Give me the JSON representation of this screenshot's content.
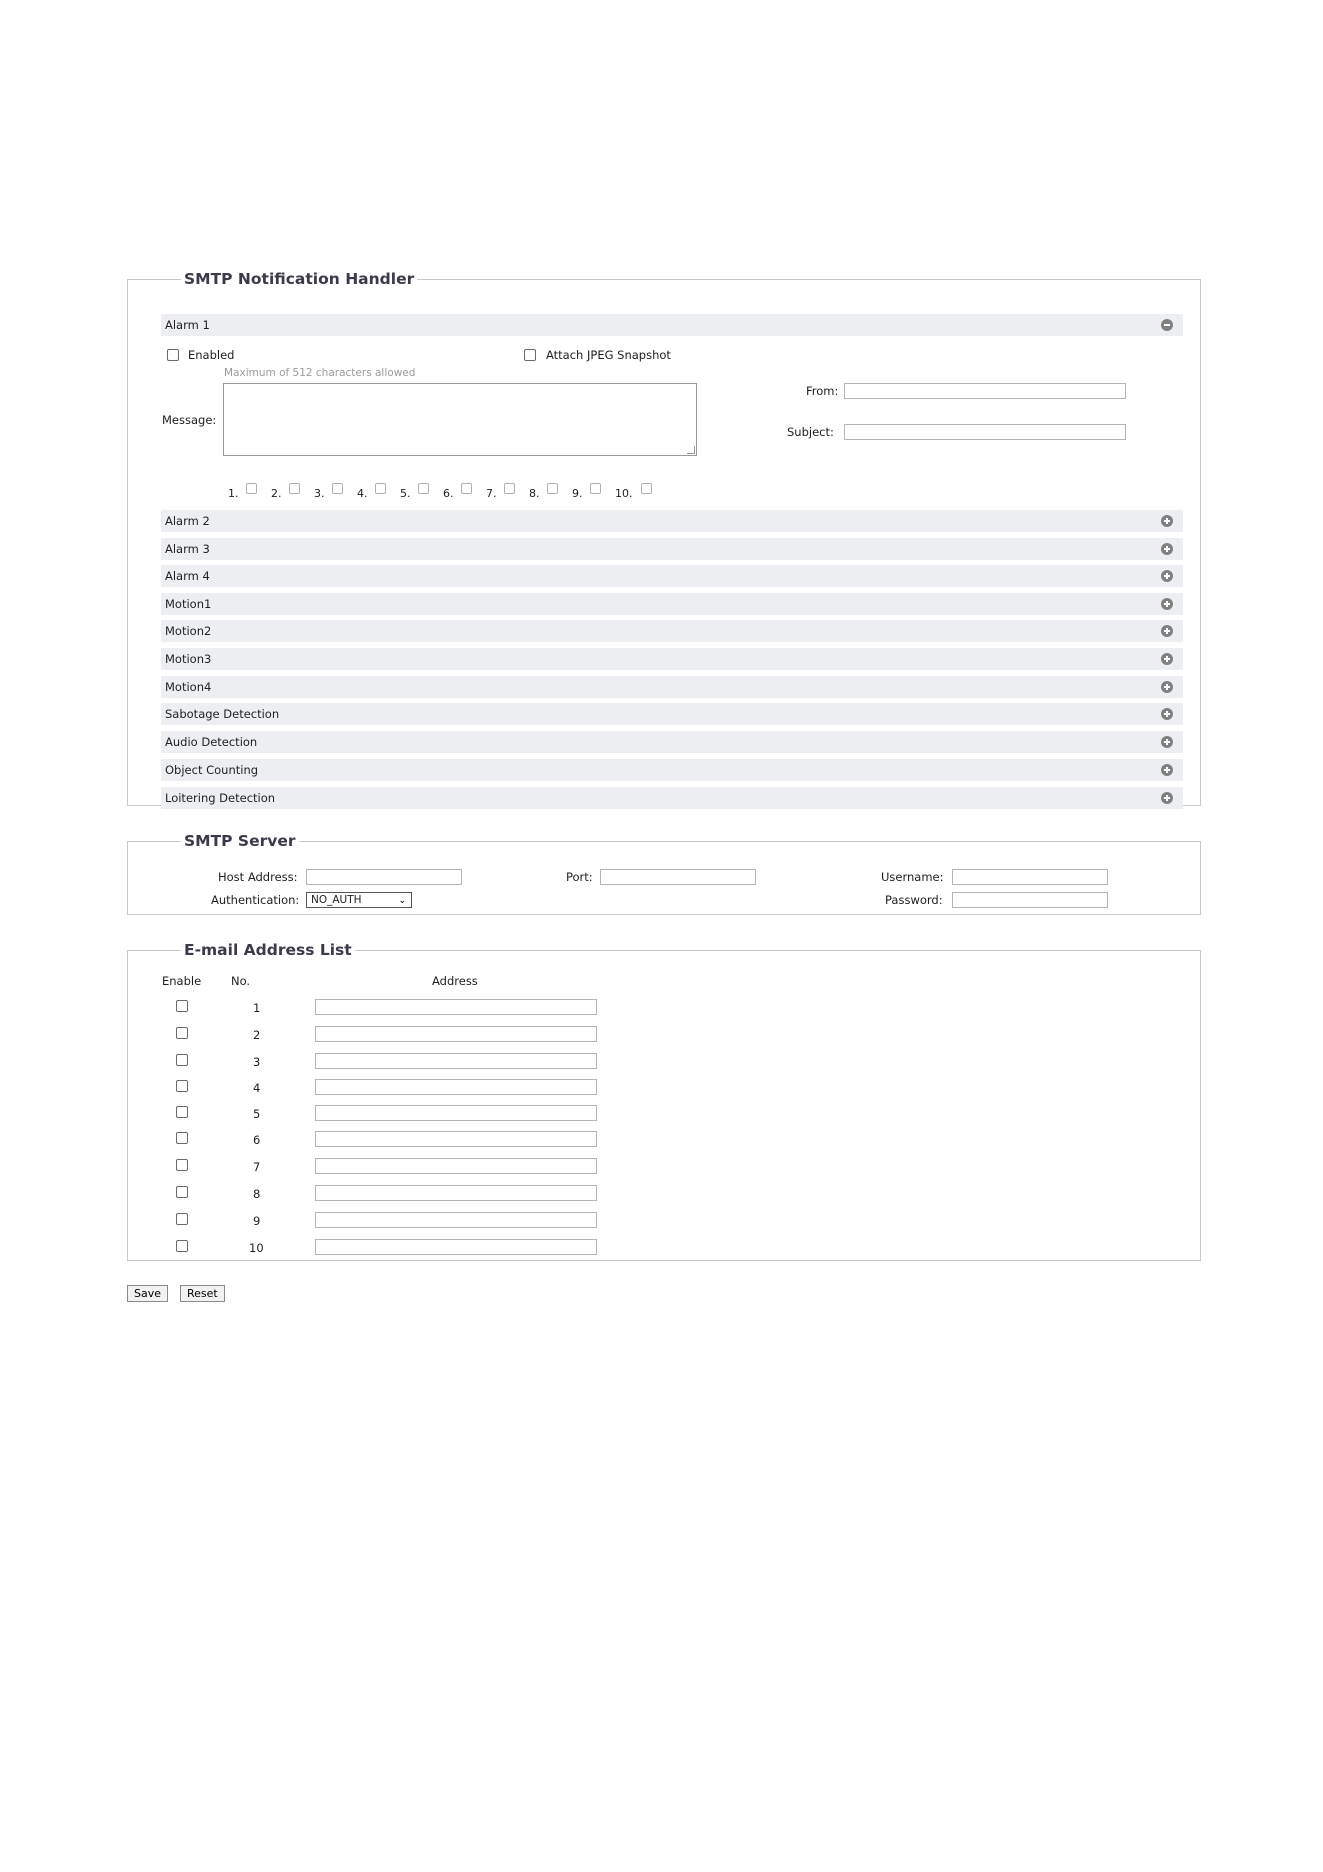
{
  "smtp_handler": {
    "legend": "SMTP Notification Handler",
    "alarm1": {
      "title": "Alarm 1",
      "enabled_label": "Enabled",
      "attach_label": "Attach JPEG Snapshot",
      "hint": "Maximum of 512 characters allowed",
      "message_label": "Message:",
      "from_label": "From:",
      "subject_label": "Subject:",
      "recipients": [
        "1.",
        "2.",
        "3.",
        "4.",
        "5.",
        "6.",
        "7.",
        "8.",
        "9.",
        "10."
      ]
    },
    "collapsed_sections": [
      "Alarm 2",
      "Alarm 3",
      "Alarm 4",
      "Motion1",
      "Motion2",
      "Motion3",
      "Motion4",
      "Sabotage Detection",
      "Audio Detection",
      "Object Counting",
      "Loitering Detection"
    ]
  },
  "smtp_server": {
    "legend": "SMTP Server",
    "host_label": "Host Address:",
    "port_label": "Port:",
    "username_label": "Username:",
    "auth_label": "Authentication:",
    "auth_value": "NO_AUTH",
    "password_label": "Password:"
  },
  "email_list": {
    "legend": "E-mail Address List",
    "col_enable": "Enable",
    "col_no": "No.",
    "col_address": "Address",
    "rows": [
      "1",
      "2",
      "3",
      "4",
      "5",
      "6",
      "7",
      "8",
      "9",
      "10"
    ]
  },
  "buttons": {
    "save": "Save",
    "reset": "Reset"
  }
}
